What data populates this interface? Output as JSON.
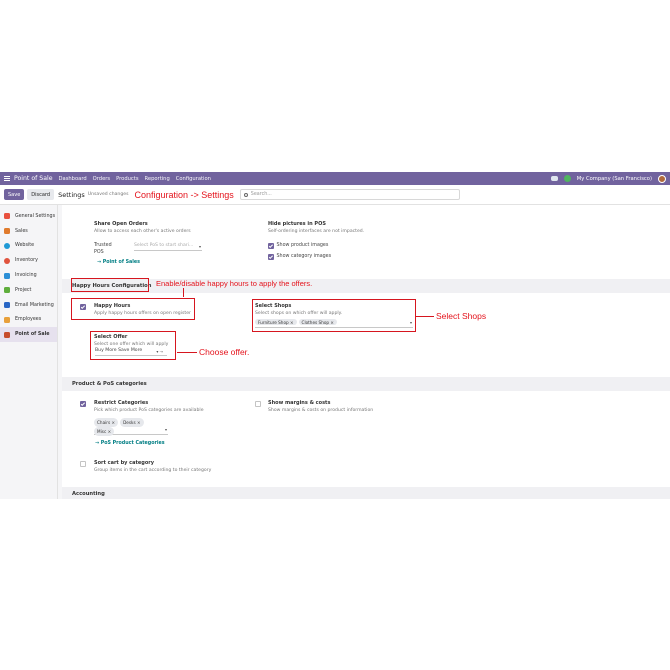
{
  "navbar": {
    "brand": "Point of Sale",
    "menu": [
      "Dashboard",
      "Orders",
      "Products",
      "Reporting",
      "Configuration"
    ],
    "company": "My Company (San Francisco)"
  },
  "control_panel": {
    "save": "Save",
    "discard": "Discard",
    "title": "Settings",
    "unsaved": "Unsaved changes",
    "annotation": "Configuration -> Settings",
    "search_placeholder": "Search..."
  },
  "sidebar": {
    "items": [
      {
        "label": "General Settings",
        "color": "#e8503e"
      },
      {
        "label": "Sales",
        "color": "#e07b2c"
      },
      {
        "label": "Website",
        "color": "#1f9ad6"
      },
      {
        "label": "Inventory",
        "color": "#e0533d"
      },
      {
        "label": "Invoicing",
        "color": "#2c8fd6"
      },
      {
        "label": "Project",
        "color": "#5fae3c"
      },
      {
        "label": "Email Marketing",
        "color": "#2a67c5"
      },
      {
        "label": "Employees",
        "color": "#e8a03a"
      },
      {
        "label": "Point of Sale",
        "color": "#c64d2c"
      }
    ],
    "active_index": 8
  },
  "settings": {
    "share_orders": {
      "title": "Share Open Orders",
      "desc": "Allow to access each other's active orders"
    },
    "trusted": {
      "label": "Trusted POS",
      "placeholder": "Select PoS to start shari...",
      "link": "→ Point of Sales"
    },
    "hide_pictures": {
      "title": "Hide pictures in POS",
      "desc": "Self-ordering interfaces are not impacted.",
      "opt1": "Show product images",
      "opt2": "Show category images"
    },
    "happy_section": {
      "title": "Happy Hours Configuration",
      "annotation": "Enable/disable happy hours to apply the offers."
    },
    "happy_hours": {
      "title": "Happy Hours",
      "desc": "Apply happy hours offers on open register"
    },
    "select_shops": {
      "title": "Select Shops",
      "desc": "Select shops on which offer will apply.",
      "tags": [
        "Furniture Shop ×",
        "Clothes Shop ×"
      ],
      "annotation": "Select Shops"
    },
    "select_offer": {
      "title": "Select Offer",
      "desc": "Select one offer which will apply",
      "value": "Buy More Save More",
      "annotation": "Choose offer."
    },
    "product_section": {
      "title": "Product & PoS categories"
    },
    "restrict": {
      "title": "Restrict Categories",
      "desc": "Pick which product PoS categories are available",
      "tags": [
        "Chairs ×",
        "Desks ×",
        "Misc ×"
      ],
      "link": "→ PoS Product Categories"
    },
    "margins": {
      "title": "Show margins & costs",
      "desc": "Show margins & costs on product information"
    },
    "sort_cart": {
      "title": "Sort cart by category",
      "desc": "Group items in the cart according to their category"
    },
    "accounting_section": {
      "title": "Accounting"
    }
  }
}
